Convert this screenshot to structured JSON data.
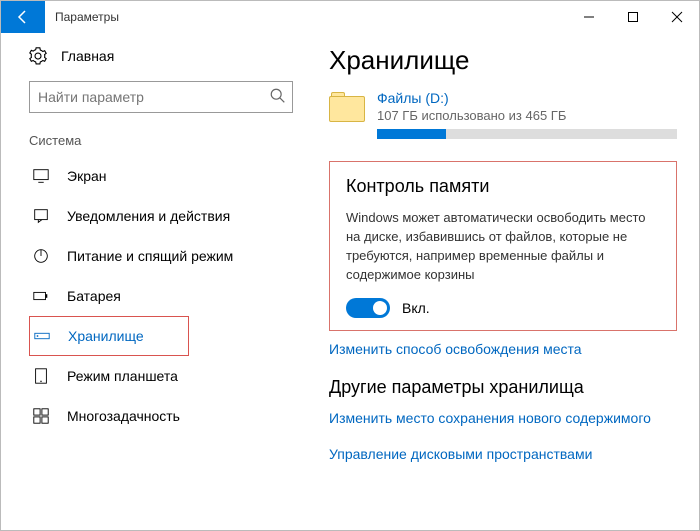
{
  "titlebar": {
    "title": "Параметры"
  },
  "sidebar": {
    "home": "Главная",
    "search_placeholder": "Найти параметр",
    "section": "Система",
    "items": [
      {
        "label": "Экран"
      },
      {
        "label": "Уведомления и действия"
      },
      {
        "label": "Питание и спящий режим"
      },
      {
        "label": "Батарея"
      },
      {
        "label": "Хранилище"
      },
      {
        "label": "Режим планшета"
      },
      {
        "label": "Многозадачность"
      }
    ]
  },
  "content": {
    "heading": "Хранилище",
    "drive": {
      "name": "Файлы (D:)",
      "usage": "107 ГБ использовано из 465 ГБ",
      "percent": 23
    },
    "sense": {
      "title": "Контроль памяти",
      "desc": "Windows может автоматически освободить место на диске, избавившись от файлов, которые не требуются, например временные файлы и содержимое корзины",
      "toggle_label": "Вкл."
    },
    "link_change": "Изменить способ освобождения места",
    "other_heading": "Другие параметры хранилища",
    "link_save": "Изменить место сохранения нового содержимого",
    "link_spaces": "Управление дисковыми пространствами"
  }
}
